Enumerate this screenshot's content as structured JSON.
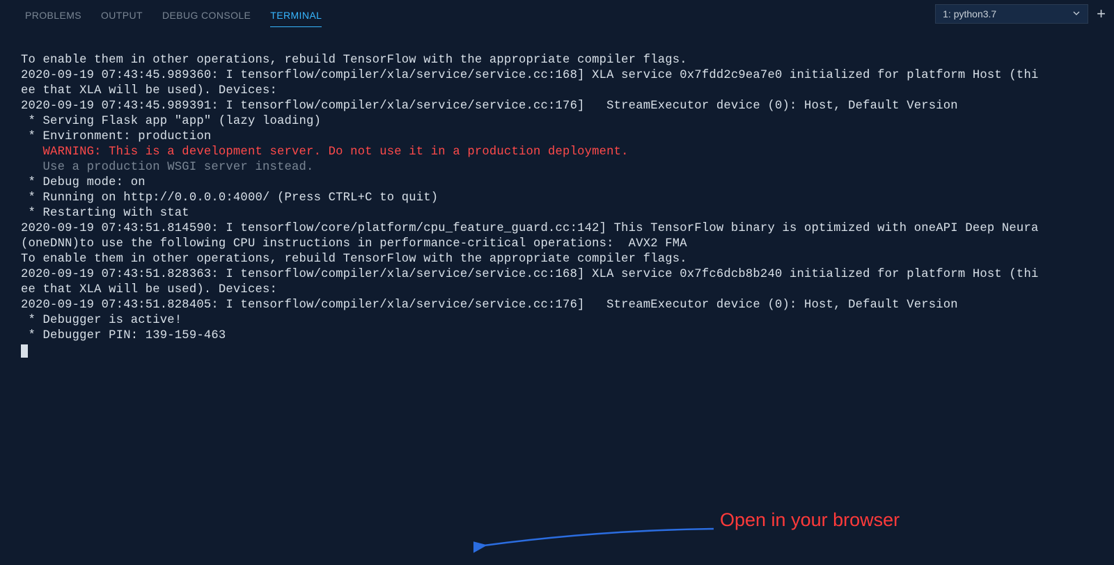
{
  "header": {
    "tabs": [
      {
        "label": "PROBLEMS",
        "active": false
      },
      {
        "label": "OUTPUT",
        "active": false
      },
      {
        "label": "DEBUG CONSOLE",
        "active": false
      },
      {
        "label": "TERMINAL",
        "active": true
      }
    ],
    "terminal_selector": "1: python3.7"
  },
  "terminal": {
    "lines": [
      {
        "cls": "line",
        "text": "To enable them in other operations, rebuild TensorFlow with the appropriate compiler flags."
      },
      {
        "cls": "line",
        "text": "2020-09-19 07:43:45.989360: I tensorflow/compiler/xla/service/service.cc:168] XLA service 0x7fdd2c9ea7e0 initialized for platform Host (thi"
      },
      {
        "cls": "line",
        "text": "ee that XLA will be used). Devices:"
      },
      {
        "cls": "line",
        "text": "2020-09-19 07:43:45.989391: I tensorflow/compiler/xla/service/service.cc:176]   StreamExecutor device (0): Host, Default Version"
      },
      {
        "cls": "line",
        "text": " * Serving Flask app \"app\" (lazy loading)"
      },
      {
        "cls": "line",
        "text": " * Environment: production"
      },
      {
        "cls": "warn-red",
        "text": "   WARNING: This is a development server. Do not use it in a production deployment."
      },
      {
        "cls": "dim",
        "text": "   Use a production WSGI server instead."
      },
      {
        "cls": "line",
        "text": " * Debug mode: on"
      },
      {
        "cls": "line",
        "text": " * Running on http://0.0.0.0:4000/ (Press CTRL+C to quit)"
      },
      {
        "cls": "line",
        "text": " * Restarting with stat"
      },
      {
        "cls": "line",
        "text": "2020-09-19 07:43:51.814590: I tensorflow/core/platform/cpu_feature_guard.cc:142] This TensorFlow binary is optimized with oneAPI Deep Neura"
      },
      {
        "cls": "line",
        "text": "(oneDNN)to use the following CPU instructions in performance-critical operations:  AVX2 FMA"
      },
      {
        "cls": "line",
        "text": "To enable them in other operations, rebuild TensorFlow with the appropriate compiler flags."
      },
      {
        "cls": "line",
        "text": "2020-09-19 07:43:51.828363: I tensorflow/compiler/xla/service/service.cc:168] XLA service 0x7fc6dcb8b240 initialized for platform Host (thi"
      },
      {
        "cls": "line",
        "text": "ee that XLA will be used). Devices:"
      },
      {
        "cls": "line",
        "text": "2020-09-19 07:43:51.828405: I tensorflow/compiler/xla/service/service.cc:176]   StreamExecutor device (0): Host, Default Version"
      },
      {
        "cls": "line",
        "text": " * Debugger is active!"
      },
      {
        "cls": "line",
        "text": " * Debugger PIN: 139-159-463"
      }
    ]
  },
  "annotation": {
    "text": "Open in your browser"
  }
}
